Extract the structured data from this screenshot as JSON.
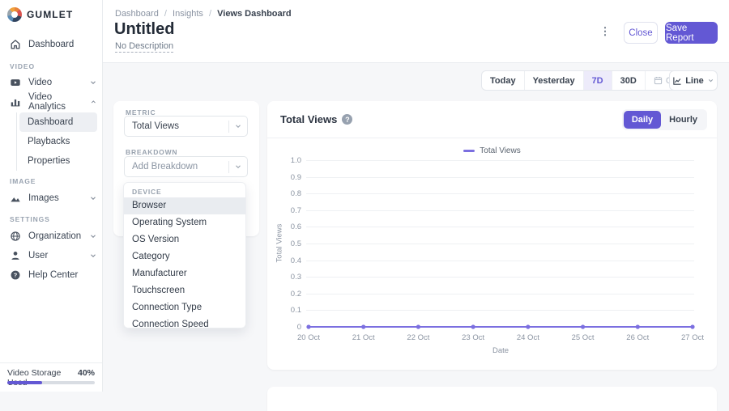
{
  "brand": {
    "name": "GUMLET"
  },
  "sidebar": {
    "dashboard": "Dashboard",
    "video_section": "VIDEO",
    "video": "Video",
    "video_analytics": "Video Analytics",
    "sub_dashboard": "Dashboard",
    "sub_playbacks": "Playbacks",
    "sub_properties": "Properties",
    "image_section": "IMAGE",
    "images": "Images",
    "settings_section": "SETTINGS",
    "organization": "Organization",
    "user": "User",
    "help_center": "Help Center",
    "storage_label": "Video Storage Used",
    "storage_percent": "40%"
  },
  "header": {
    "crumb1": "Dashboard",
    "crumb2": "Insights",
    "crumb3": "Views Dashboard",
    "separator": "/",
    "title": "Untitled",
    "description": "No Description",
    "kebab": "⋮",
    "close": "Close",
    "save": "Save Report"
  },
  "controls": {
    "today": "Today",
    "yesterday": "Yesterday",
    "d7": "7D",
    "d30": "30D",
    "custom": "Custom",
    "chart_type": "Line"
  },
  "metric_panel": {
    "metric_label": "METRIC",
    "metric_value": "Total Views",
    "breakdown_label": "BREAKDOWN",
    "breakdown_placeholder": "Add Breakdown",
    "dropdown": {
      "group_label": "DEVICE",
      "active_item": "Browser",
      "items": [
        "Browser",
        "Operating System",
        "OS Version",
        "Category",
        "Manufacturer",
        "Touchscreen",
        "Connection Type",
        "Connection Speed"
      ]
    }
  },
  "chart_panel": {
    "title": "Total Views",
    "info": "?",
    "daily": "Daily",
    "hourly": "Hourly"
  },
  "chart_data": {
    "type": "line",
    "title": "Total Views",
    "x": [
      "20 Oct",
      "21 Oct",
      "22 Oct",
      "23 Oct",
      "24 Oct",
      "25 Oct",
      "26 Oct",
      "27 Oct"
    ],
    "series": [
      {
        "name": "Total Views",
        "values": [
          0,
          0,
          0,
          0,
          0,
          0,
          0,
          0
        ]
      }
    ],
    "xlabel": "Date",
    "ylabel": "Total Views",
    "ylim": [
      0,
      1.0
    ],
    "yticks": [
      0,
      0.1,
      0.2,
      0.3,
      0.4,
      0.5,
      0.6,
      0.7,
      0.8,
      0.9,
      1.0
    ],
    "grid": true,
    "legend_position": "top-center",
    "line_color": "#7b6fe0"
  },
  "colors": {
    "accent": "#6358d4",
    "accent_light_bg": "#edebfa",
    "line": "#7b6fe0",
    "progress": "#6358d4",
    "background": "#f6f7f9"
  }
}
